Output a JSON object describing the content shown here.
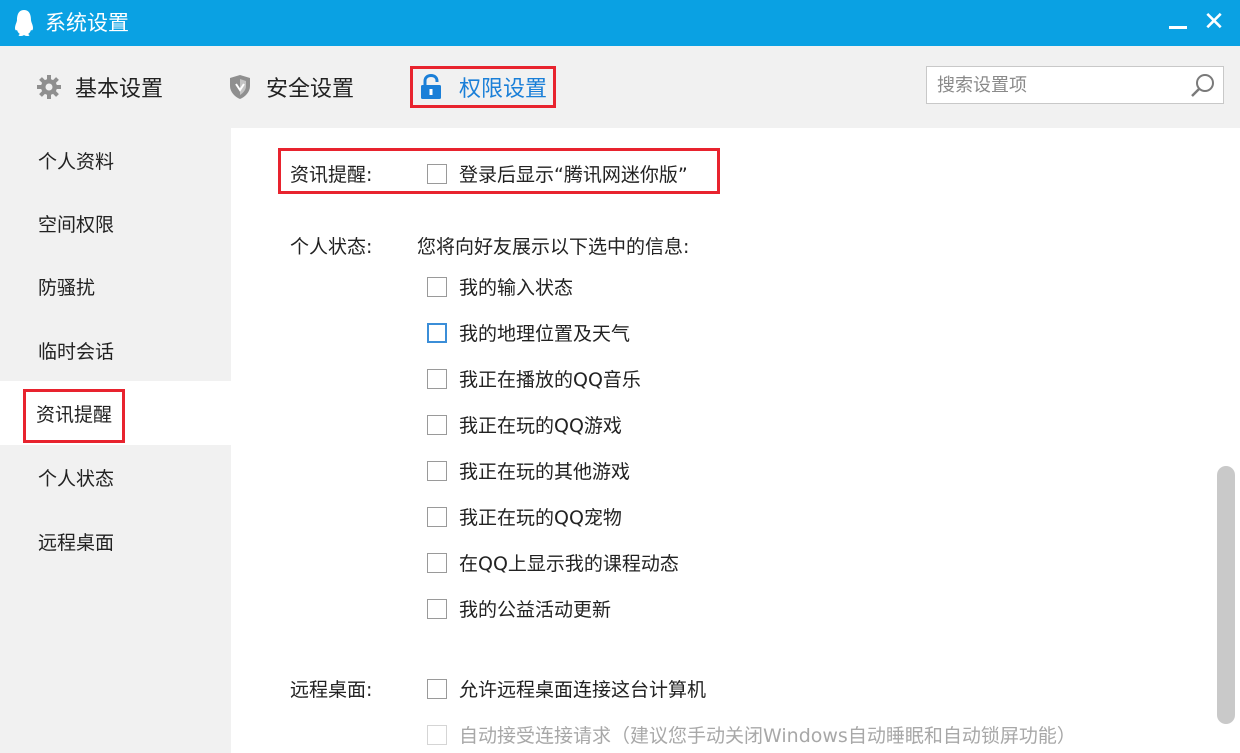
{
  "window": {
    "title": "系统设置",
    "minimize_label": "—",
    "close_label": "✕"
  },
  "tabs": [
    {
      "label": "基本设置",
      "icon": "gear-icon"
    },
    {
      "label": "安全设置",
      "icon": "shield-icon"
    },
    {
      "label": "权限设置",
      "icon": "lock-icon",
      "active": true
    }
  ],
  "search": {
    "placeholder": "搜索设置项"
  },
  "sidebar": {
    "items": [
      {
        "label": "个人资料"
      },
      {
        "label": "空间权限"
      },
      {
        "label": "防骚扰"
      },
      {
        "label": "临时会话"
      },
      {
        "label": "资讯提醒",
        "active": true
      },
      {
        "label": "个人状态"
      },
      {
        "label": "远程桌面"
      }
    ]
  },
  "content": {
    "news": {
      "label": "资讯提醒:",
      "option": "登录后显示“腾讯网迷你版”"
    },
    "status": {
      "label": "个人状态:",
      "description": "您将向好友展示以下选中的信息:",
      "options": [
        "我的输入状态",
        "我的地理位置及天气",
        "我正在播放的QQ音乐",
        "我正在玩的QQ游戏",
        "我正在玩的其他游戏",
        "我正在玩的QQ宠物",
        "在QQ上显示我的课程动态",
        "我的公益活动更新"
      ]
    },
    "remote": {
      "label": "远程桌面:",
      "option": "允许远程桌面连接这台计算机",
      "sub_option": "自动接受连接请求（建议您手动关闭Windows自动睡眠和自动锁屏功能）"
    }
  },
  "colors": {
    "titlebar": "#0aa1e3",
    "accent": "#1a7fd8",
    "highlight_box": "#e8232e"
  }
}
